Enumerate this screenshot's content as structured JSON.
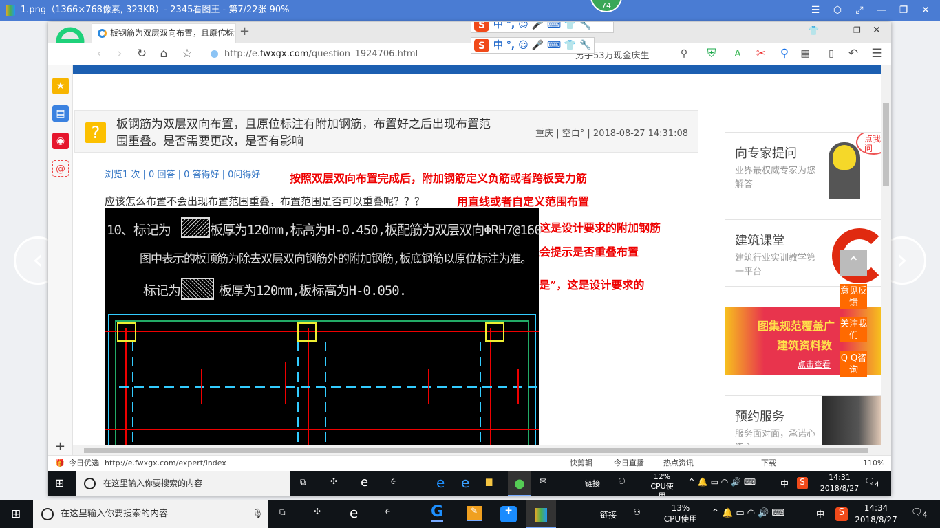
{
  "viewer": {
    "title": "1.png（1366×768像素, 323KB）- 2345看图王 - 第7/22张 90%",
    "badge": "74",
    "prev_icon": "chevron-left-icon",
    "next_icon": "chevron-right-icon"
  },
  "ime": {
    "items": [
      "中",
      "°,"
    ]
  },
  "browser": {
    "tab_title": "板钢筋为双层双向布置，且原位标注有附加钢筋，布置好之后出现布置范围重叠",
    "url_prefix": "http://e.",
    "url_domain": "fwxgx.com",
    "url_path": "/question_1924706.html",
    "search_placeholder": "男子53万现金庆生",
    "status": {
      "left_label": "今日优选",
      "hover_url": "http://e.fwxgx.com/expert/index",
      "items": [
        "快剪辑",
        "今日直播",
        "热点资讯",
        "下载"
      ],
      "zoom": "110%"
    }
  },
  "question": {
    "title": "板钢筋为双层双向布置，且原位标注有附加钢筋，布置好之后出现布置范围重叠。是否需要更改，是否有影响",
    "meta": "重庆 | 空白° | 2018-08-27 14:31:08",
    "stats": "浏览1 次 | 0 回答 | 0 答得好 | 0问得好",
    "body": "应该怎么布置不会出现布置范围重叠，布置范围是否可以重叠呢？？？",
    "cad_lines": [
      "10、标记为",
      "板厚为120mm,标高为H-0.450,板配筋为双层双向ΦRH7@160",
      "图中表示的板顶筋为除去双层双向钢筋外的附加钢筋,板底钢筋以原位标注为准。",
      "标记为",
      "板厚为120mm,板标高为H-0.050."
    ]
  },
  "annotations": [
    "按照双层双向布置完成后，附加钢筋定义负筋或者跨板受力筋",
    "用直线或者自定义范围布置",
    "这是设计要求的附加钢筋",
    "软件是会提示是否重叠布置",
    "定“是”，这是设计要求的"
  ],
  "sidebar_cards": [
    {
      "title": "向专家提问",
      "desc": "业界最权威专家为您解答",
      "bubble": "点我提问"
    },
    {
      "title": "建筑课堂",
      "desc": "建筑行业实训教学第一平台"
    },
    {
      "banner_line1": "图集规范覆盖广",
      "banner_line2": "建筑资料数",
      "banner_link": "点击查看"
    },
    {
      "title": "预约服务",
      "desc": "服务面对面，承诺心连心"
    }
  ],
  "float_buttons": [
    "意见反馈",
    "关注我们",
    "Q Q咨询"
  ],
  "inner_taskbar": {
    "search": "在这里输入你要搜索的内容",
    "link": "链接",
    "cpu_pct": "12%",
    "cpu_label": "CPU使用",
    "ime": "中",
    "time": "14:31",
    "date": "2018/8/27",
    "notif": "4"
  },
  "outer_taskbar": {
    "search": "在这里输入你要搜索的内容",
    "link": "链接",
    "cpu_pct": "13%",
    "cpu_label": "CPU使用",
    "ime": "中",
    "time": "14:34",
    "date": "2018/8/27",
    "notif": "4"
  },
  "colors": {
    "accent": "#1c5fb1",
    "annotation": "#ee0000",
    "float": "#ff6a00"
  }
}
